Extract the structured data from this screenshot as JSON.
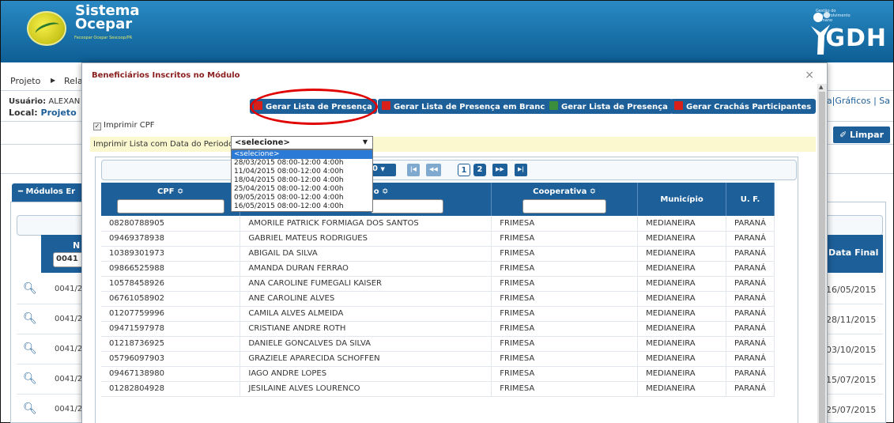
{
  "header": {
    "logo_title_line1": "Sistema",
    "logo_title_line2": "Ocepar",
    "logo_subtitle": "Fecoopar  Ocepar  Sescoop/PR",
    "brand_right": "GDH",
    "brand_right_small": "Gestão do Desenvolvimento Humano"
  },
  "menu": {
    "items": [
      "Projeto",
      "Rela"
    ]
  },
  "session": {
    "user_label": "Usuário:",
    "user_value": "ALEXAN",
    "local_label": "Local:",
    "local_value": "Projeto",
    "right_links": "pa|Gráficos | Sa"
  },
  "background_page": {
    "buttons": [
      "ar",
      "Limpar"
    ],
    "modulos_tab": "Módulos Er",
    "field_value": "0041",
    "col_n": "N",
    "col_data_final": "Data Final",
    "rows": [
      {
        "code": "0041/2",
        "date": "16/05/2015"
      },
      {
        "code": "0041/2",
        "date": "28/11/2015"
      },
      {
        "code": "0041/2",
        "date": "03/10/2015"
      },
      {
        "code": "0041/2",
        "date": "15/07/2015"
      },
      {
        "code": "0041/2",
        "date": "25/07/2015"
      }
    ]
  },
  "modal": {
    "title": "Beneficiários Inscritos no Módulo",
    "close": "×",
    "actions": [
      {
        "label": "Gerar Lista de Presença",
        "icon": "pdf-icon"
      },
      {
        "label": "Gerar Lista de Presença em Branco",
        "icon": "pdf-icon"
      },
      {
        "label": "Gerar Lista de Presença",
        "icon": "xls-icon"
      },
      {
        "label": "Gerar Crachás Participantes",
        "icon": "pdf-icon"
      }
    ],
    "imprimir_cpf": "Imprimir CPF",
    "periodo_label": "Imprimir Lista com Data do Periodo:",
    "periodo_selected": "<selecione>",
    "periodo_options": [
      "<selecione>",
      "28/03/2015 08:00-12:00 4:00h",
      "11/04/2015 08:00-12:00 4:00h",
      "18/04/2015 08:00-12:00 4:00h",
      "25/04/2015 08:00-12:00 4:00h",
      "09/05/2015 08:00-12:00 4:00h",
      "16/05/2015 08:00-12:00 4:00h"
    ],
    "pager": {
      "page_size": "0",
      "first": "|◀",
      "prev": "◀◀",
      "pages": [
        "1",
        "2"
      ],
      "next": "▶▶",
      "last": "▶|"
    },
    "columns": [
      "CPF ≎",
      "eficiário ≎",
      "Cooperativa ≎",
      "Município",
      "U. F."
    ],
    "rows": [
      [
        "08280788905",
        "AMORILE PATRICK FORMIAGA DOS SANTOS",
        "FRIMESA",
        "MEDIANEIRA",
        "PARANÁ"
      ],
      [
        "09469378938",
        "GABRIEL MATEUS RODRIGUES",
        "FRIMESA",
        "MEDIANEIRA",
        "PARANÁ"
      ],
      [
        "10389301973",
        "ABIGAIL DA SILVA",
        "FRIMESA",
        "MEDIANEIRA",
        "PARANÁ"
      ],
      [
        "09866525988",
        "AMANDA DURAN FERRAO",
        "FRIMESA",
        "MEDIANEIRA",
        "PARANÁ"
      ],
      [
        "10578458926",
        "ANA CAROLINE FUMEGALI KAISER",
        "FRIMESA",
        "MEDIANEIRA",
        "PARANÁ"
      ],
      [
        "06761058902",
        "ANE CAROLINE ALVES",
        "FRIMESA",
        "MEDIANEIRA",
        "PARANÁ"
      ],
      [
        "01207759996",
        "CAMILA ALVES ALMEIDA",
        "FRIMESA",
        "MEDIANEIRA",
        "PARANÁ"
      ],
      [
        "09471597978",
        "CRISTIANE ANDRE ROTH",
        "FRIMESA",
        "MEDIANEIRA",
        "PARANÁ"
      ],
      [
        "01218736925",
        "DANIELE GONCALVES DA SILVA",
        "FRIMESA",
        "MEDIANEIRA",
        "PARANÁ"
      ],
      [
        "05796097903",
        "GRAZIELE APARECIDA SCHOFFEN",
        "FRIMESA",
        "MEDIANEIRA",
        "PARANÁ"
      ],
      [
        "09467138980",
        "IAGO ANDRE LOPES",
        "FRIMESA",
        "MEDIANEIRA",
        "PARANÁ"
      ],
      [
        "01282804928",
        "JESILAINE ALVES LOURENCO",
        "FRIMESA",
        "MEDIANEIRA",
        "PARANÁ"
      ]
    ]
  }
}
